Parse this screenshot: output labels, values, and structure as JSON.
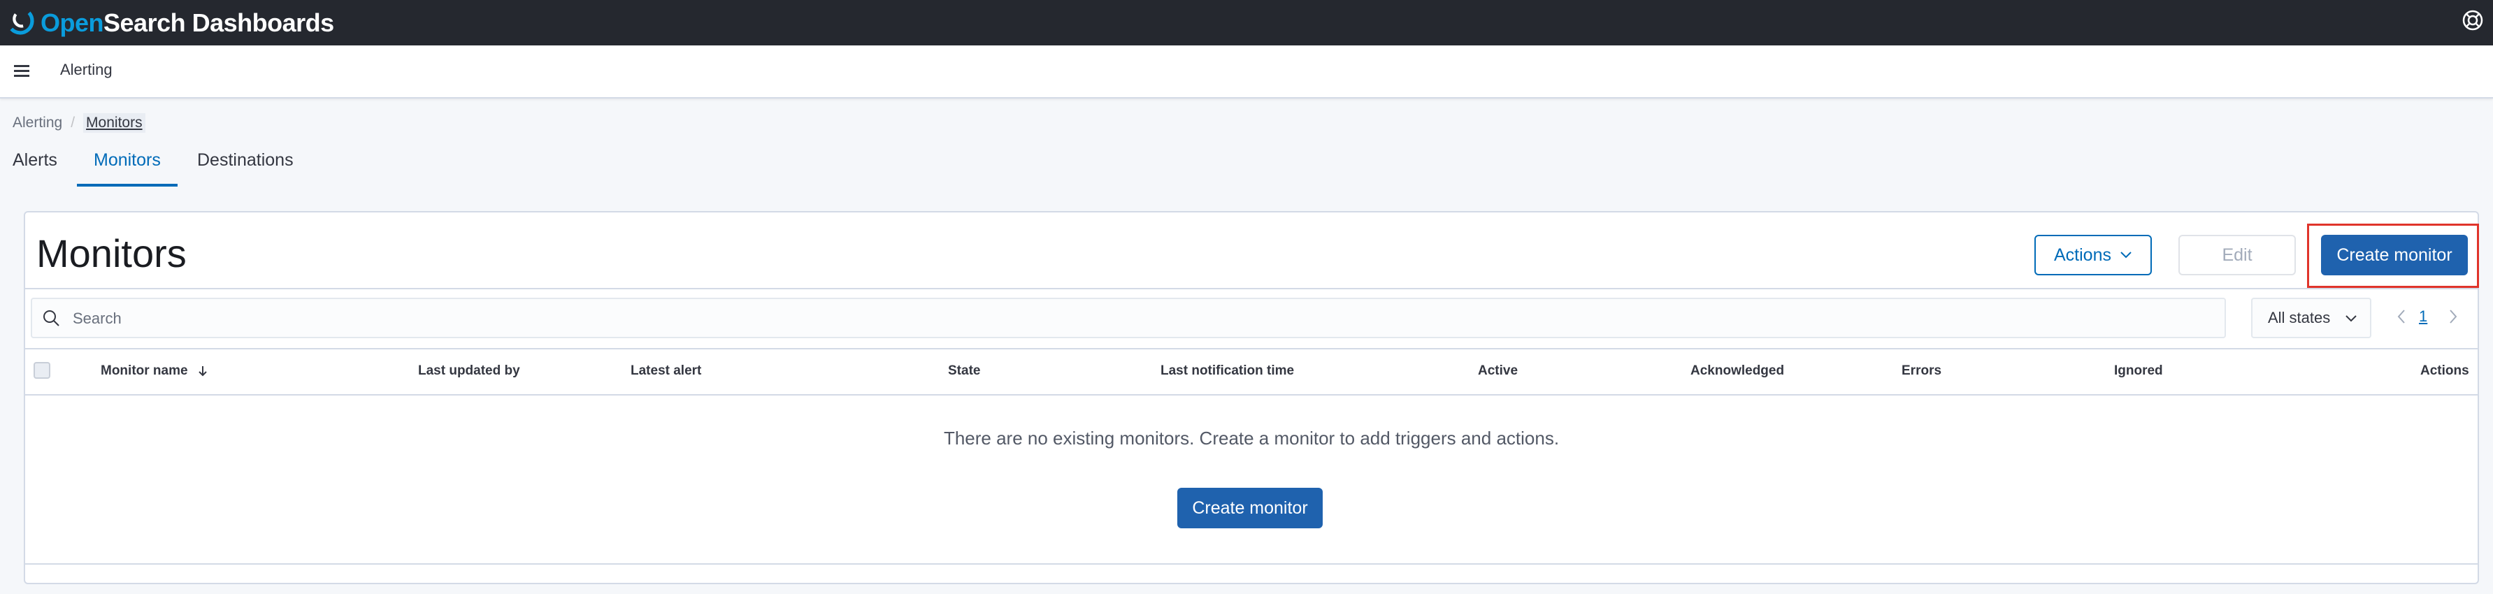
{
  "header": {
    "logo": {
      "brand_open": "Open",
      "brand_rest": "Search Dashboards",
      "icon": "opensearch-logo-icon"
    },
    "help_icon": "help-lifebuoy-icon"
  },
  "subheader": {
    "menu_icon": "hamburger-menu-icon",
    "app_title": "Alerting"
  },
  "breadcrumb": {
    "items": [
      "Alerting",
      "Monitors"
    ],
    "separator": "/"
  },
  "tabs": [
    {
      "label": "Alerts",
      "active": false
    },
    {
      "label": "Monitors",
      "active": true
    },
    {
      "label": "Destinations",
      "active": false
    }
  ],
  "panel": {
    "title": "Monitors",
    "actions_label": "Actions",
    "edit_label": "Edit",
    "create_label": "Create monitor"
  },
  "filters": {
    "search_placeholder": "Search",
    "states_value": "All states",
    "page_current": "1"
  },
  "table": {
    "columns": [
      "Monitor name",
      "Last updated by",
      "Latest alert",
      "State",
      "Last notification time",
      "Active",
      "Acknowledged",
      "Errors",
      "Ignored",
      "Actions"
    ],
    "sort_column": "Monitor name",
    "empty_message": "There are no existing monitors. Create a monitor to add triggers and actions.",
    "empty_cta": "Create monitor"
  },
  "colors": {
    "primary": "#1f62ae",
    "link": "#006bb8",
    "highlight": "#e0342b",
    "header_bg": "#25282f"
  }
}
